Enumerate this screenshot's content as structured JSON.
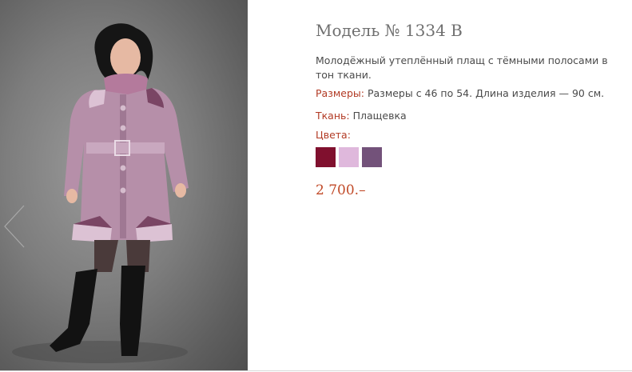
{
  "product": {
    "title": "Модель № 1334 В",
    "description": "Молодёжный утеплённый плащ с тёмными полосами в тон ткани.",
    "sizes_label": "Размеры:",
    "sizes_value": "Размеры с 46 по 54. Длина изделия — 90 см.",
    "fabric_label": "Ткань:",
    "fabric_value": "Плащевка",
    "colors_label": "Цвета:",
    "colors": [
      "#80102e",
      "#dfb8dc",
      "#73527a"
    ],
    "price": "2 700.–"
  },
  "gallery": {
    "prev_icon": "chevron-left-icon"
  },
  "accent_color": "#b23a24"
}
